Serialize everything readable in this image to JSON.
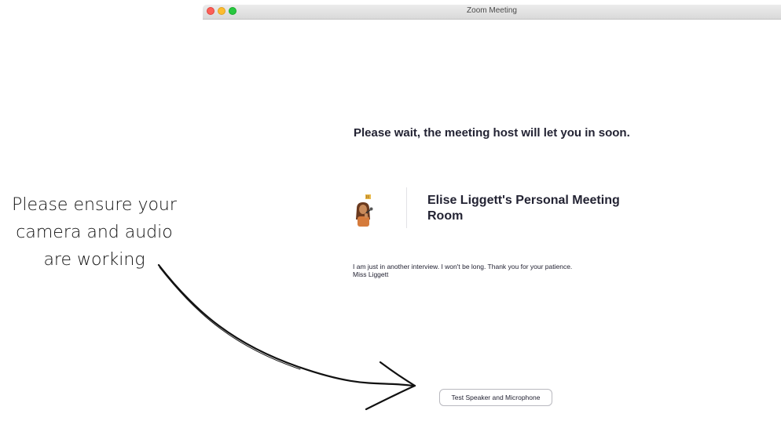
{
  "window": {
    "title": "Zoom Meeting",
    "controls": [
      "close",
      "minimize",
      "maximize"
    ]
  },
  "waiting_room": {
    "status_message": "Please wait, the meeting host will let you in soon.",
    "room_name": "Elise Liggett's Personal Meeting Room",
    "avatar_icon": "bitmoji-avatar",
    "host_message": "I am just in another interview. I won't be long. Thank you for your patience.\nMiss Liggett",
    "test_button_label": "Test Speaker and Microphone"
  },
  "annotation": {
    "lines": [
      "Please ensure your",
      "camera and audio",
      "are working"
    ],
    "arrow_icon": "hand-drawn-arrow"
  }
}
